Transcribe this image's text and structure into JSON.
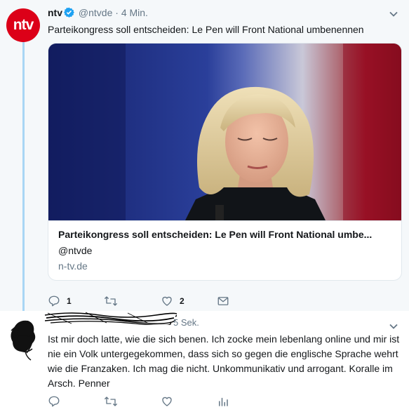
{
  "tweet1": {
    "avatar_text": "ntv",
    "display_name": "ntv",
    "handle": "@ntvde",
    "separator": "·",
    "time": "4 Min.",
    "text": "Parteikongress soll entscheiden: Le Pen will Front National umbenennen",
    "card": {
      "title": "Parteikongress soll entscheiden: Le Pen will Front National umbe...",
      "handle": "@ntvde",
      "domain": "n-tv.de"
    },
    "actions": {
      "reply_count": "1",
      "retweet_count": "",
      "like_count": "2"
    }
  },
  "tweet2": {
    "time": "5 Sek.",
    "text": "Ist mir doch latte, wie die sich benen. Ich zocke mein lebenlang online und mir ist nie ein Volk untergegekommen, dass sich so gegen die englische Sprache wehrt wie die Franzaken. Ich mag die nicht. Unkommunikativ und arrogant. Koralle im Arsch. Penner"
  },
  "colors": {
    "accent": "#1da1f2",
    "thread_line": "#a9d6f5",
    "ntv_red": "#dc0018",
    "muted": "#657786",
    "tweet1_bg": "#f5f8fa"
  },
  "icons": [
    "ntv-logo",
    "verified-badge",
    "chevron-down-icon",
    "reply-icon",
    "retweet-icon",
    "like-icon",
    "message-icon",
    "analytics-icon"
  ]
}
